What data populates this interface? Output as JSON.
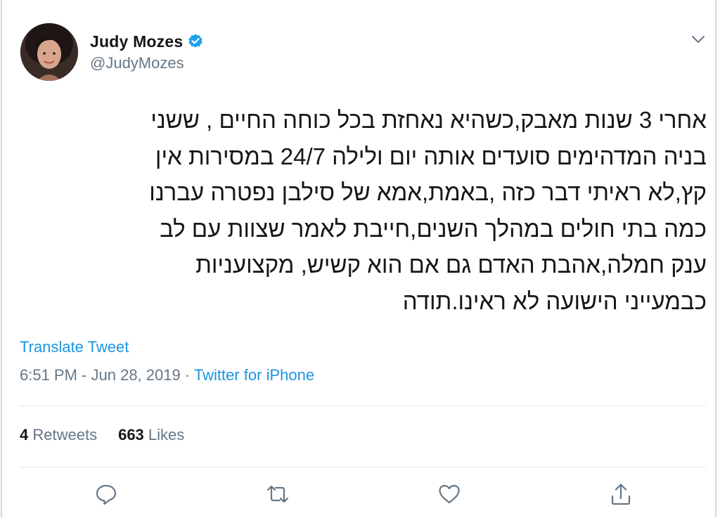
{
  "user": {
    "display_name": "Judy Mozes",
    "handle": "@JudyMozes",
    "verified": true
  },
  "tweet": {
    "lines": [
      "אחרי 3 שנות מאבק,כשהיא נאחזת בכל כוחה החיים , ששני",
      "בניה המדהימים סועדים אותה יום ולילה 24/7 במסירות אין",
      "קץ,לא ראיתי דבר כזה ,באמת,אמא של סילבן נפטרה עברנו",
      "כמה בתי חולים במהלך השנים,חייבת לאמר שצוות עם לב",
      "ענק חמלה,אהבת האדם גם אם הוא קשיש, מקצועניות",
      "כבמעייני הישועה לא ראינו.תודה"
    ],
    "translate_label": "Translate Tweet",
    "time": "6:51 PM",
    "date": "Jun 28, 2019",
    "separator": " · ",
    "source": "Twitter for iPhone"
  },
  "stats": {
    "retweets_count": "4",
    "retweets_label": " Retweets",
    "likes_count": "663",
    "likes_label": " Likes"
  },
  "icons": {
    "verified": "verified-badge-icon",
    "menu": "chevron-down-icon",
    "reply": "reply-icon",
    "retweet": "retweet-icon",
    "like": "heart-icon",
    "share": "share-icon"
  },
  "colors": {
    "link": "#1b95e0",
    "muted_text": "#657786",
    "icon_grey": "#657786",
    "verified_blue": "#1da1f2"
  }
}
